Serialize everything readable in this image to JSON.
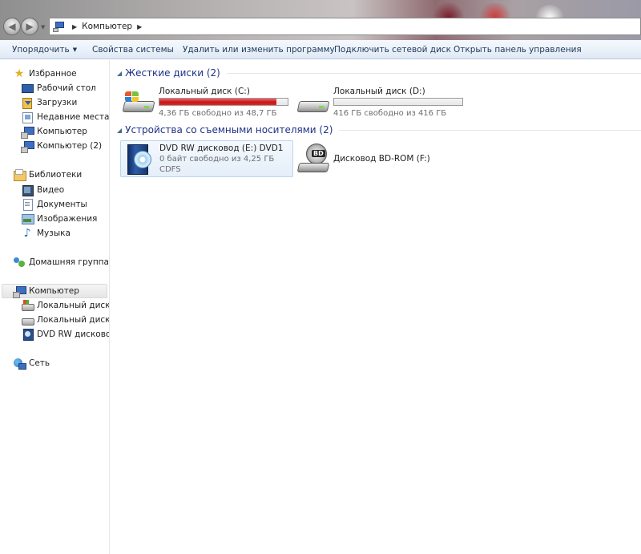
{
  "window": {
    "address": {
      "crumb": "Компьютер"
    }
  },
  "toolbar": {
    "organize": "Упорядочить",
    "system_properties": "Свойства системы",
    "uninstall": "Удалить или изменить программу",
    "map_drive": "Подключить сетевой диск",
    "control_panel": "Открыть панель управления"
  },
  "sidebar": {
    "favorites": {
      "label": "Избранное",
      "items": [
        "Рабочий стол",
        "Загрузки",
        "Недавние места",
        "Компьютер",
        "Компьютер (2)"
      ]
    },
    "libraries": {
      "label": "Библиотеки",
      "items": [
        "Видео",
        "Документы",
        "Изображения",
        "Музыка"
      ]
    },
    "homegroup": "Домашняя группа",
    "computer": {
      "label": "Компьютер",
      "items": [
        "Локальный диск (C",
        "Локальный диск (D",
        "DVD RW дисковод ("
      ]
    },
    "network": "Сеть"
  },
  "content": {
    "hard_disks": {
      "title": "Жесткие диски (2)",
      "drives": [
        {
          "name": "Локальный диск (C:)",
          "free": "4,36 ГБ свободно из 48,7 ГБ",
          "used_fraction": 0.91
        },
        {
          "name": "Локальный диск (D:)",
          "free": "416 ГБ свободно из 416 ГБ",
          "used_fraction": 0.0
        }
      ]
    },
    "removable": {
      "title": "Устройства со съемными носителями (2)",
      "devices": [
        {
          "name": "DVD RW дисковод (E:) DVD1",
          "free": "0 байт свободно из 4,25 ГБ",
          "fs": "CDFS"
        },
        {
          "name": "Дисковод BD-ROM (F:)"
        }
      ]
    }
  },
  "colors": {
    "usage_bar_full": "#cc1212",
    "group_title": "#1e3287",
    "toolbar_text": "#1e395b"
  }
}
